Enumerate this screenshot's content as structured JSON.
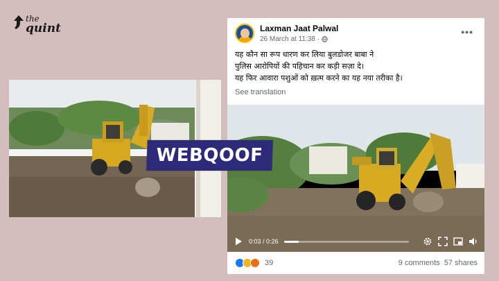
{
  "logo": {
    "line1": "the",
    "line2": "quint"
  },
  "badge": {
    "label": "WEBQOOF"
  },
  "post": {
    "author": "Laxman Jaat Palwal",
    "timestamp": "26 March at 11:38",
    "text_lines": [
      "यह कौन सा रूप धारण कर लिया बुलडोजर बाबा ने",
      "पुलिस आरोपियों की पहिचान कर कड़ी सज़ा दे।",
      "यह फिर आवारा पशुओं को ख़त्म करने का यह नया तरीका है।"
    ],
    "see_translation": "See translation",
    "video": {
      "current_time": "0:03",
      "duration": "0:26",
      "progress_fraction": 0.12
    },
    "reactions_count": "39",
    "comments": "9 comments",
    "shares": "57 shares"
  },
  "colors": {
    "background": "#d3bdbd",
    "badge_bg": "#2e2a7a",
    "fb_blue": "#1877f2"
  },
  "icons": [
    "quint-logo-icon",
    "globe-icon",
    "more-icon",
    "play-icon",
    "settings-icon",
    "fullscreen-icon",
    "pip-icon",
    "volume-icon",
    "like-reaction-icon",
    "sad-reaction-icon",
    "angry-reaction-icon"
  ]
}
